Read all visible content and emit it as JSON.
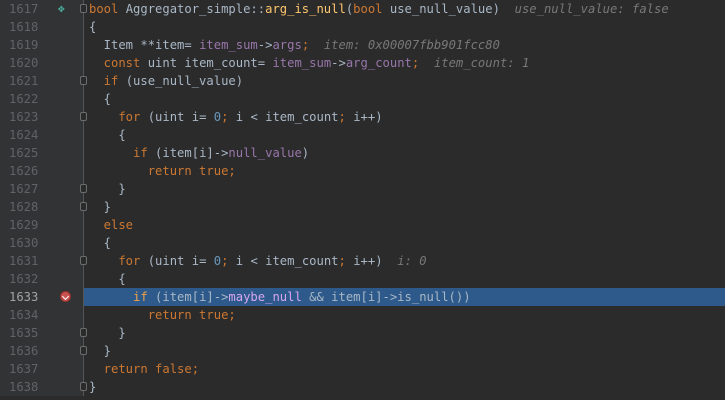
{
  "lines": [
    {
      "num": "1617",
      "tokens": [
        [
          "kw",
          "bool "
        ],
        [
          "op",
          "Aggregator_simple::"
        ],
        [
          "fn",
          "arg_is_null"
        ],
        [
          "op",
          "("
        ],
        [
          "kw",
          "bool "
        ],
        [
          "op",
          "use_null_value)  "
        ],
        [
          "hint",
          "use_null_value: false"
        ]
      ]
    },
    {
      "num": "1618",
      "tokens": [
        [
          "op",
          "{"
        ]
      ]
    },
    {
      "num": "1619",
      "tokens": [
        [
          "op",
          "  Item **item= "
        ],
        [
          "field",
          "item_sum"
        ],
        [
          "op",
          "->"
        ],
        [
          "field",
          "args"
        ],
        [
          "kw",
          ";  "
        ],
        [
          "hint",
          "item: 0x00007fbb901fcc80"
        ]
      ]
    },
    {
      "num": "1620",
      "tokens": [
        [
          "kw",
          "  const "
        ],
        [
          "op",
          "uint item_count= "
        ],
        [
          "field",
          "item_sum"
        ],
        [
          "op",
          "->"
        ],
        [
          "field",
          "arg_count"
        ],
        [
          "kw",
          ";  "
        ],
        [
          "hint",
          "item_count: 1"
        ]
      ]
    },
    {
      "num": "1621",
      "tokens": [
        [
          "kw",
          "  if "
        ],
        [
          "op",
          "(use_null_value)"
        ]
      ]
    },
    {
      "num": "1622",
      "tokens": [
        [
          "op",
          "  {"
        ]
      ]
    },
    {
      "num": "1623",
      "tokens": [
        [
          "kw",
          "    for "
        ],
        [
          "op",
          "(uint i= "
        ],
        [
          "num",
          "0"
        ],
        [
          "kw",
          "; "
        ],
        [
          "op",
          "i < item_count"
        ],
        [
          "kw",
          "; "
        ],
        [
          "op",
          "i++)"
        ]
      ]
    },
    {
      "num": "1624",
      "tokens": [
        [
          "op",
          "    {"
        ]
      ]
    },
    {
      "num": "1625",
      "tokens": [
        [
          "kw",
          "      if "
        ],
        [
          "op",
          "(item[i]->"
        ],
        [
          "field",
          "null_value"
        ],
        [
          "op",
          ")"
        ]
      ]
    },
    {
      "num": "1626",
      "tokens": [
        [
          "kw",
          "        return true;"
        ]
      ]
    },
    {
      "num": "1627",
      "tokens": [
        [
          "op",
          "    }"
        ]
      ]
    },
    {
      "num": "1628",
      "tokens": [
        [
          "op",
          "  }"
        ]
      ]
    },
    {
      "num": "1629",
      "tokens": [
        [
          "kw",
          "  else"
        ]
      ]
    },
    {
      "num": "1630",
      "tokens": [
        [
          "op",
          "  {"
        ]
      ]
    },
    {
      "num": "1631",
      "tokens": [
        [
          "kw",
          "    for "
        ],
        [
          "op",
          "(uint i= "
        ],
        [
          "num",
          "0"
        ],
        [
          "kw",
          "; "
        ],
        [
          "op",
          "i < item_count"
        ],
        [
          "kw",
          "; "
        ],
        [
          "op",
          "i++)  "
        ],
        [
          "hint",
          "i: 0"
        ]
      ]
    },
    {
      "num": "1632",
      "tokens": [
        [
          "op",
          "    {"
        ]
      ]
    },
    {
      "num": "1633",
      "tokens": [
        [
          "kw",
          "      if "
        ],
        [
          "op",
          "(item[i]->"
        ],
        [
          "field",
          "maybe_null"
        ],
        [
          "op",
          " && item[i]->is_null())"
        ]
      ]
    },
    {
      "num": "1634",
      "tokens": [
        [
          "kw",
          "        return true;"
        ]
      ]
    },
    {
      "num": "1635",
      "tokens": [
        [
          "op",
          "    }"
        ]
      ]
    },
    {
      "num": "1636",
      "tokens": [
        [
          "op",
          "  }"
        ]
      ]
    },
    {
      "num": "1637",
      "tokens": [
        [
          "kw",
          "  return false;"
        ]
      ]
    },
    {
      "num": "1638",
      "tokens": [
        [
          "op",
          "}"
        ]
      ]
    }
  ],
  "execution_line": "1633",
  "breakpoint_line": "1633",
  "run_marker_line": "1617",
  "run_marker_icon": "debug-run-icon",
  "fold_lines": [
    "1617",
    "1621",
    "1623",
    "1627",
    "1628",
    "1631",
    "1635",
    "1636",
    "1638"
  ],
  "colors": {
    "background": "#2b2b2b",
    "exec_highlight": "#2d5a8a",
    "breakpoint": "#c75450"
  }
}
